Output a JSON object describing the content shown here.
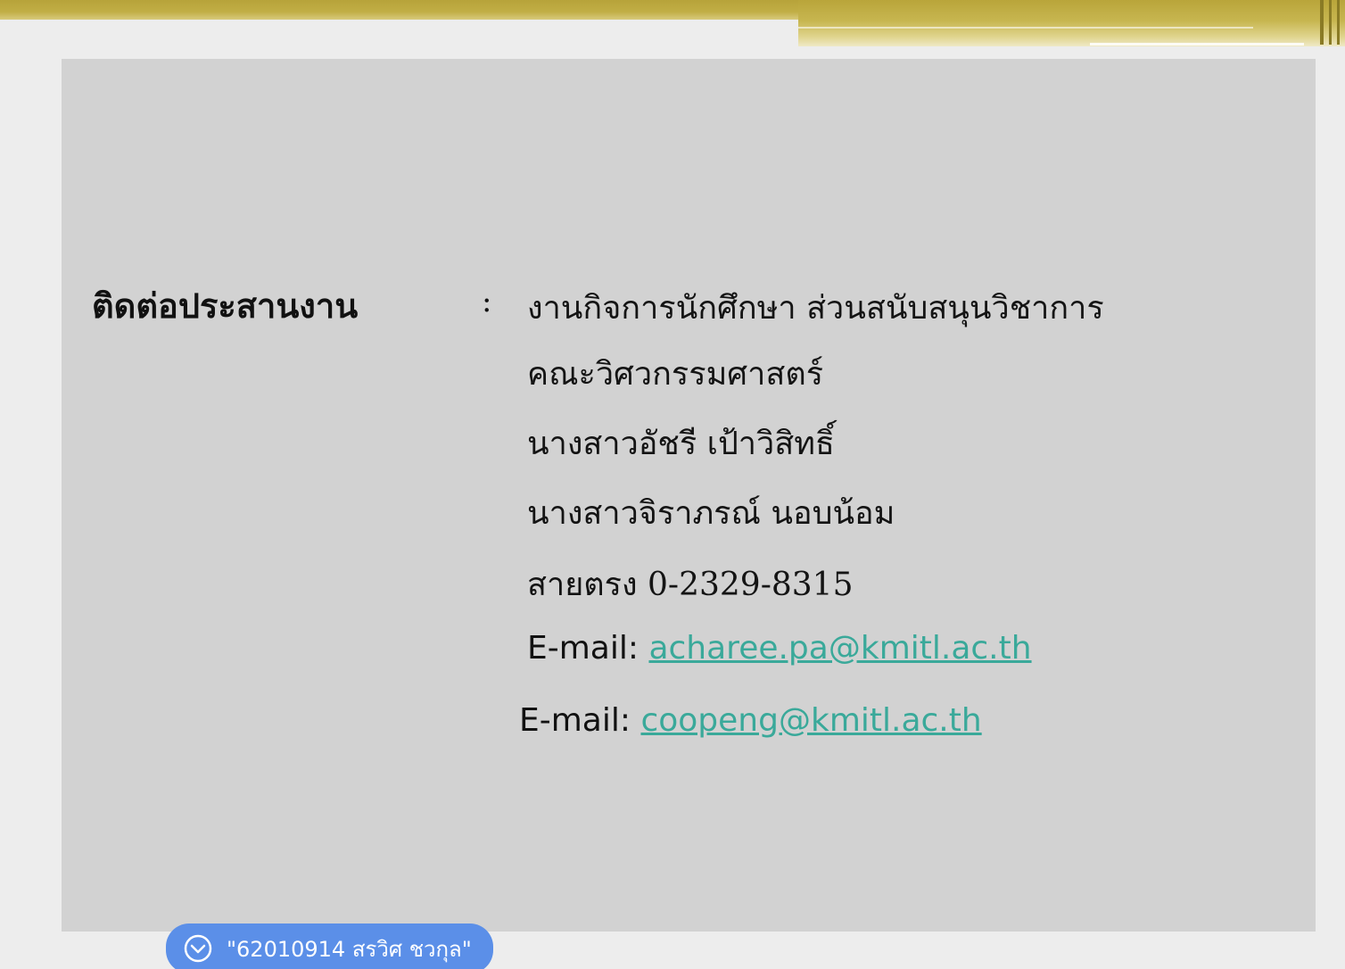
{
  "slide": {
    "label": "ติดต่อประสานงาน",
    "colon": ":",
    "lines": [
      "งานกิจการนักศึกษา ส่วนสนับสนุนวิชาการ",
      "คณะวิศวกรรมศาสตร์",
      "นางสาวอัชรี  เป้าวิสิทธิ์",
      "นางสาวจิราภรณ์  นอบน้อม",
      "สายตรง  0-2329-8315"
    ],
    "emails": [
      {
        "label": "E-mail:",
        "address": "acharee.pa@kmitl.ac.th"
      },
      {
        "label": "E-mail:",
        "address": "coopeng@kmitl.ac.th"
      }
    ]
  },
  "caption_pill": {
    "icon": "chevron-down-circle-icon",
    "text": "\"62010914 สรวิศ ชวกุล\"",
    "color": "#5b8fe8"
  },
  "colors": {
    "accent_gold": "#c1ae45",
    "link": "#3aa99a",
    "slide_bg": "#d2d2d2"
  }
}
